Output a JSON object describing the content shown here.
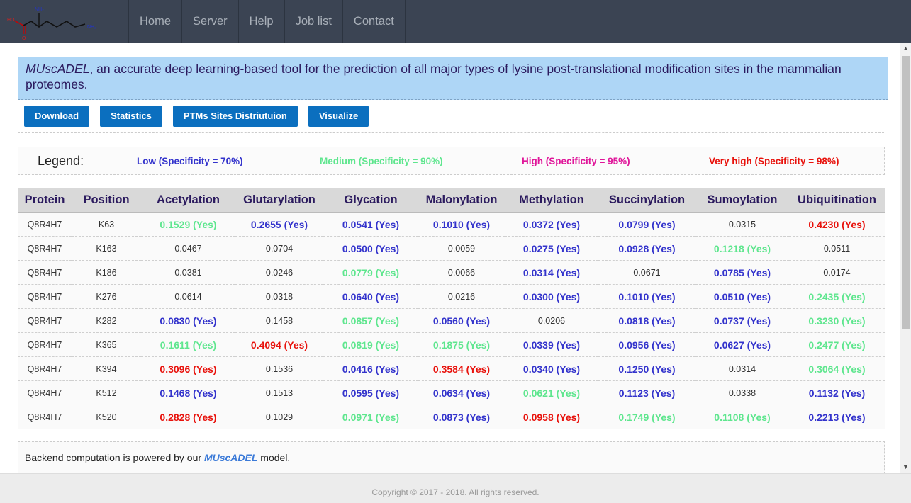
{
  "nav": {
    "items": [
      "Home",
      "Server",
      "Help",
      "Job list",
      "Contact"
    ]
  },
  "logo": {
    "labels": [
      "NH₂",
      "HO",
      "O",
      "NH₂"
    ]
  },
  "banner": {
    "name": "MUscADEL",
    "rest": ", an accurate deep learning-based tool for the prediction of all major types of lysine post-translational modification sites in the mammalian proteomes."
  },
  "buttons": [
    "Download",
    "Statistics",
    "PTMs Sites Distriutuion",
    "Visualize"
  ],
  "legend": {
    "title": "Legend:",
    "items": [
      {
        "label": "Low (Specificity = 70%)",
        "color": "#3333cc"
      },
      {
        "label": "Medium (Specificity = 90%)",
        "color": "#5ee68e"
      },
      {
        "label": "High (Specificity = 95%)",
        "color": "#e0169a"
      },
      {
        "label": "Very high (Specificity = 98%)",
        "color": "#e8120c"
      }
    ]
  },
  "colors": {
    "low": "#3333cc",
    "medium": "#5ee68e",
    "high": "#e0169a",
    "veryhigh": "#e8120c"
  },
  "table": {
    "headers": [
      "Protein",
      "Position",
      "Acetylation",
      "Glutarylation",
      "Glycation",
      "Malonylation",
      "Methylation",
      "Succinylation",
      "Sumoylation",
      "Ubiquitination"
    ],
    "rows": [
      {
        "protein": "Q8R4H7",
        "position": "K63",
        "cells": [
          {
            "text": "0.1529 (Yes)",
            "level": "medium"
          },
          {
            "text": "0.2655 (Yes)",
            "level": "low"
          },
          {
            "text": "0.0541 (Yes)",
            "level": "low"
          },
          {
            "text": "0.1010 (Yes)",
            "level": "low"
          },
          {
            "text": "0.0372 (Yes)",
            "level": "low"
          },
          {
            "text": "0.0799 (Yes)",
            "level": "low"
          },
          {
            "text": "0.0315",
            "level": "none"
          },
          {
            "text": "0.4230 (Yes)",
            "level": "veryhigh"
          }
        ]
      },
      {
        "protein": "Q8R4H7",
        "position": "K163",
        "cells": [
          {
            "text": "0.0467",
            "level": "none"
          },
          {
            "text": "0.0704",
            "level": "none"
          },
          {
            "text": "0.0500 (Yes)",
            "level": "low"
          },
          {
            "text": "0.0059",
            "level": "none"
          },
          {
            "text": "0.0275 (Yes)",
            "level": "low"
          },
          {
            "text": "0.0928 (Yes)",
            "level": "low"
          },
          {
            "text": "0.1218 (Yes)",
            "level": "medium"
          },
          {
            "text": "0.0511",
            "level": "none"
          }
        ]
      },
      {
        "protein": "Q8R4H7",
        "position": "K186",
        "cells": [
          {
            "text": "0.0381",
            "level": "none"
          },
          {
            "text": "0.0246",
            "level": "none"
          },
          {
            "text": "0.0779 (Yes)",
            "level": "medium"
          },
          {
            "text": "0.0066",
            "level": "none"
          },
          {
            "text": "0.0314 (Yes)",
            "level": "low"
          },
          {
            "text": "0.0671",
            "level": "none"
          },
          {
            "text": "0.0785 (Yes)",
            "level": "low"
          },
          {
            "text": "0.0174",
            "level": "none"
          }
        ]
      },
      {
        "protein": "Q8R4H7",
        "position": "K276",
        "cells": [
          {
            "text": "0.0614",
            "level": "none"
          },
          {
            "text": "0.0318",
            "level": "none"
          },
          {
            "text": "0.0640 (Yes)",
            "level": "low"
          },
          {
            "text": "0.0216",
            "level": "none"
          },
          {
            "text": "0.0300 (Yes)",
            "level": "low"
          },
          {
            "text": "0.1010 (Yes)",
            "level": "low"
          },
          {
            "text": "0.0510 (Yes)",
            "level": "low"
          },
          {
            "text": "0.2435 (Yes)",
            "level": "medium"
          }
        ]
      },
      {
        "protein": "Q8R4H7",
        "position": "K282",
        "cells": [
          {
            "text": "0.0830 (Yes)",
            "level": "low"
          },
          {
            "text": "0.1458",
            "level": "none"
          },
          {
            "text": "0.0857 (Yes)",
            "level": "medium"
          },
          {
            "text": "0.0560 (Yes)",
            "level": "low"
          },
          {
            "text": "0.0206",
            "level": "none"
          },
          {
            "text": "0.0818 (Yes)",
            "level": "low"
          },
          {
            "text": "0.0737 (Yes)",
            "level": "low"
          },
          {
            "text": "0.3230 (Yes)",
            "level": "medium"
          }
        ]
      },
      {
        "protein": "Q8R4H7",
        "position": "K365",
        "cells": [
          {
            "text": "0.1611 (Yes)",
            "level": "medium"
          },
          {
            "text": "0.4094 (Yes)",
            "level": "veryhigh"
          },
          {
            "text": "0.0819 (Yes)",
            "level": "medium"
          },
          {
            "text": "0.1875 (Yes)",
            "level": "medium"
          },
          {
            "text": "0.0339 (Yes)",
            "level": "low"
          },
          {
            "text": "0.0956 (Yes)",
            "level": "low"
          },
          {
            "text": "0.0627 (Yes)",
            "level": "low"
          },
          {
            "text": "0.2477 (Yes)",
            "level": "medium"
          }
        ]
      },
      {
        "protein": "Q8R4H7",
        "position": "K394",
        "cells": [
          {
            "text": "0.3096 (Yes)",
            "level": "veryhigh"
          },
          {
            "text": "0.1536",
            "level": "none"
          },
          {
            "text": "0.0416 (Yes)",
            "level": "low"
          },
          {
            "text": "0.3584 (Yes)",
            "level": "veryhigh"
          },
          {
            "text": "0.0340 (Yes)",
            "level": "low"
          },
          {
            "text": "0.1250 (Yes)",
            "level": "low"
          },
          {
            "text": "0.0314",
            "level": "none"
          },
          {
            "text": "0.3064 (Yes)",
            "level": "medium"
          }
        ]
      },
      {
        "protein": "Q8R4H7",
        "position": "K512",
        "cells": [
          {
            "text": "0.1468 (Yes)",
            "level": "low"
          },
          {
            "text": "0.1513",
            "level": "none"
          },
          {
            "text": "0.0595 (Yes)",
            "level": "low"
          },
          {
            "text": "0.0634 (Yes)",
            "level": "low"
          },
          {
            "text": "0.0621 (Yes)",
            "level": "medium"
          },
          {
            "text": "0.1123 (Yes)",
            "level": "low"
          },
          {
            "text": "0.0338",
            "level": "none"
          },
          {
            "text": "0.1132 (Yes)",
            "level": "low"
          }
        ]
      },
      {
        "protein": "Q8R4H7",
        "position": "K520",
        "cells": [
          {
            "text": "0.2828 (Yes)",
            "level": "veryhigh"
          },
          {
            "text": "0.1029",
            "level": "none"
          },
          {
            "text": "0.0971 (Yes)",
            "level": "medium"
          },
          {
            "text": "0.0873 (Yes)",
            "level": "low"
          },
          {
            "text": "0.0958 (Yes)",
            "level": "veryhigh"
          },
          {
            "text": "0.1749 (Yes)",
            "level": "medium"
          },
          {
            "text": "0.1108 (Yes)",
            "level": "medium"
          },
          {
            "text": "0.2213 (Yes)",
            "level": "low"
          }
        ]
      }
    ]
  },
  "footer": {
    "prefix": "Backend computation is powered by our ",
    "model": "MUscADEL",
    "suffix": " model."
  },
  "copyright": "Copyright © 2017 - 2018. All rights reserved."
}
